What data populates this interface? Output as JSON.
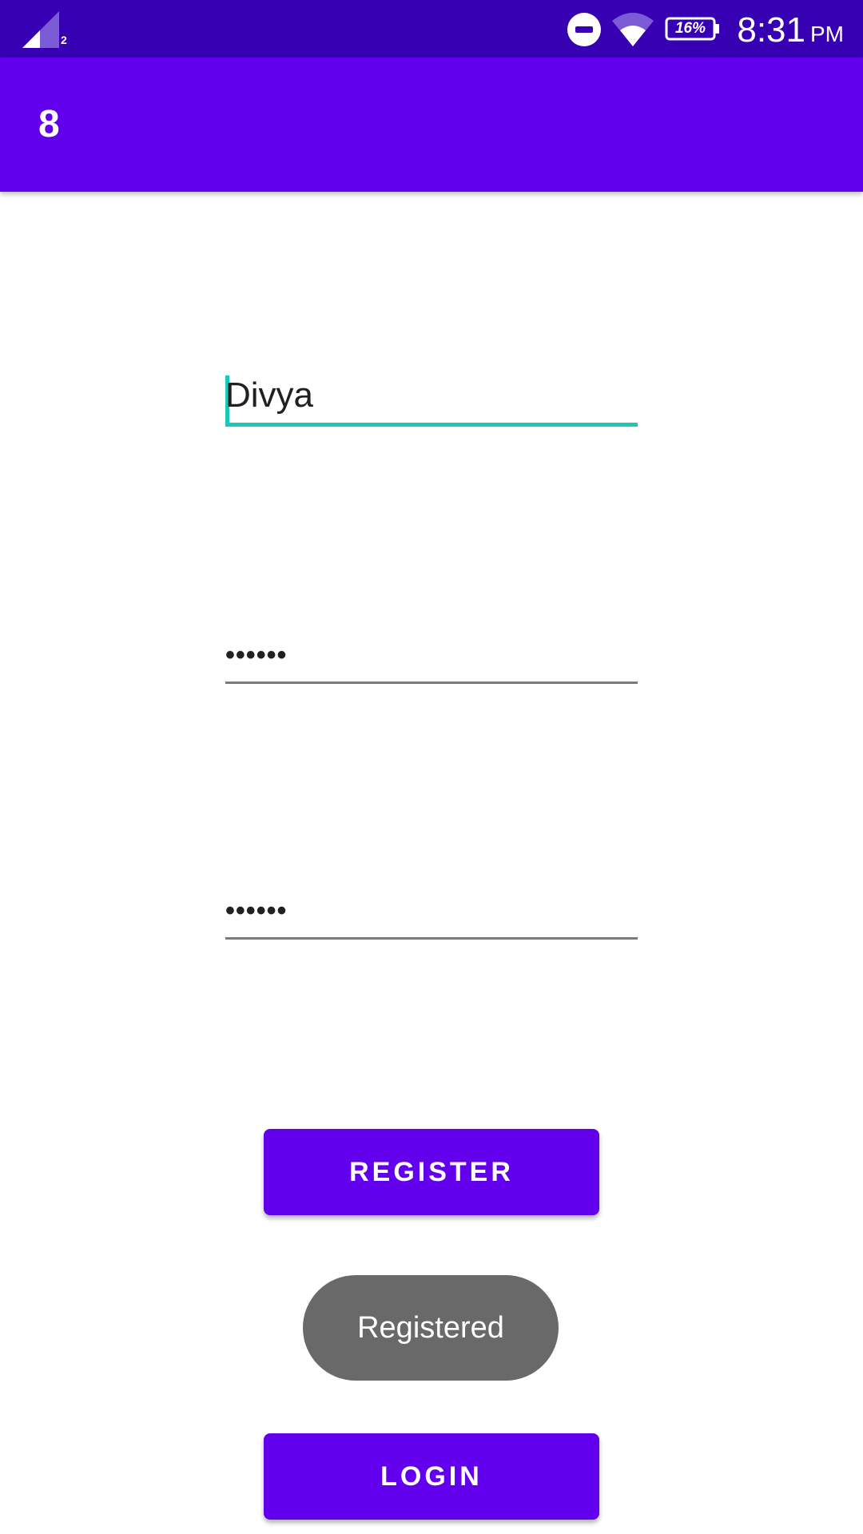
{
  "status_bar": {
    "sim_label": "2",
    "battery": "16%",
    "time": "8:31",
    "ampm": "PM",
    "icons": [
      "signal-icon",
      "do-not-disturb-icon",
      "wifi-icon",
      "battery-icon"
    ],
    "background": "#3700b3"
  },
  "app_bar": {
    "title": "8",
    "background": "#6200ee"
  },
  "form": {
    "username_value": "Divya",
    "password_value": "••••••",
    "confirm_password_value": "••••••",
    "focus_color": "#18c9b6"
  },
  "buttons": {
    "register_label": "REGISTER",
    "login_label": "LOGIN",
    "color": "#6200ee"
  },
  "toast": {
    "message": "Registered"
  }
}
